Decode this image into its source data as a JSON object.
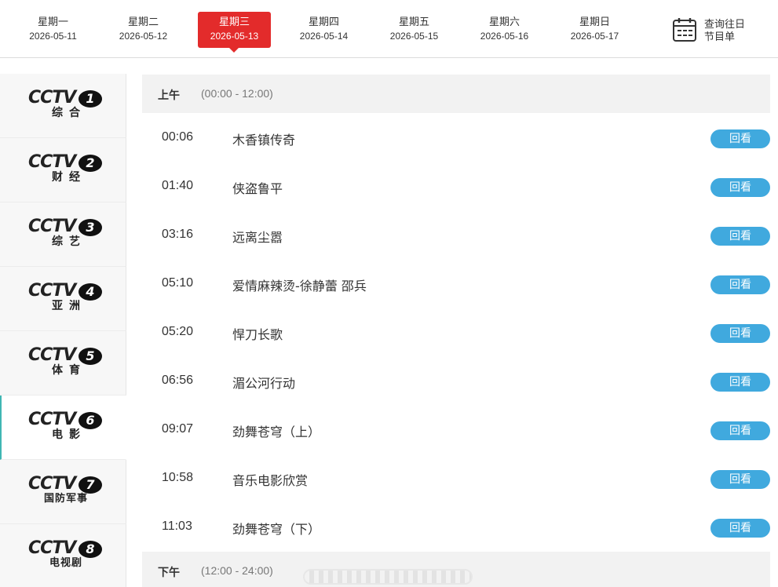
{
  "days": [
    {
      "weekday": "星期一",
      "date": "2026-05-11",
      "active": false
    },
    {
      "weekday": "星期二",
      "date": "2026-05-12",
      "active": false
    },
    {
      "weekday": "星期三",
      "date": "2026-05-13",
      "active": true
    },
    {
      "weekday": "星期四",
      "date": "2026-05-14",
      "active": false
    },
    {
      "weekday": "星期五",
      "date": "2026-05-15",
      "active": false
    },
    {
      "weekday": "星期六",
      "date": "2026-05-16",
      "active": false
    },
    {
      "weekday": "星期日",
      "date": "2026-05-17",
      "active": false
    }
  ],
  "history": {
    "label_line1": "查询往日",
    "label_line2": "节目单",
    "icon": "calendar-icon"
  },
  "channels": [
    {
      "mark": "CCTV",
      "num": "1",
      "name": "综合"
    },
    {
      "mark": "CCTV",
      "num": "2",
      "name": "财经"
    },
    {
      "mark": "CCTV",
      "num": "3",
      "name": "综艺"
    },
    {
      "mark": "CCTV",
      "num": "4",
      "name": "亚洲"
    },
    {
      "mark": "CCTV",
      "num": "5",
      "name": "体育"
    },
    {
      "mark": "CCTV",
      "num": "6",
      "name": "电影",
      "active": true
    },
    {
      "mark": "CCTV",
      "num": "7",
      "name": "国防军事"
    },
    {
      "mark": "CCTV",
      "num": "8",
      "name": "电视剧"
    }
  ],
  "morning": {
    "label": "上午",
    "range": "(00:00 - 12:00)"
  },
  "afternoon": {
    "label": "下午",
    "range": "(12:00 - 24:00)"
  },
  "replay_label": "回看",
  "programs": [
    {
      "time": "00:06",
      "title": "木香镇传奇"
    },
    {
      "time": "01:40",
      "title": "侠盗鲁平"
    },
    {
      "time": "03:16",
      "title": "远离尘嚣"
    },
    {
      "time": "05:10",
      "title": "爱情麻辣烫-徐静蕾 邵兵"
    },
    {
      "time": "05:20",
      "title": "悍刀长歌"
    },
    {
      "time": "06:56",
      "title": "湄公河行动"
    },
    {
      "time": "09:07",
      "title": "劲舞苍穹（上）"
    },
    {
      "time": "10:58",
      "title": "音乐电影欣赏"
    },
    {
      "time": "11:03",
      "title": "劲舞苍穹（下）"
    }
  ],
  "colors": {
    "accent_red": "#e32b2b",
    "replay_blue": "#40a9de",
    "active_border": "#3fb6b3"
  }
}
